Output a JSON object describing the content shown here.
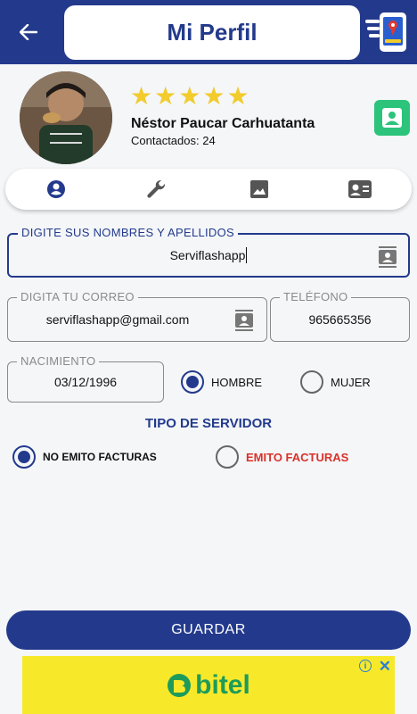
{
  "header": {
    "title": "Mi Perfil"
  },
  "colors": {
    "primary": "#233a8c",
    "star": "#f2cb2c",
    "contact_green": "#2bc47a",
    "danger_text": "#d9322b",
    "ad_bg": "#f7e92a",
    "ad_brand": "#1e9b5a"
  },
  "profile": {
    "rating_stars": 5,
    "name": "Néstor Paucar Carhuatanta",
    "contacts": "Contactados: 24"
  },
  "tabs": [
    {
      "icon": "user-circle-icon"
    },
    {
      "icon": "wrench-icon"
    },
    {
      "icon": "image-icon"
    },
    {
      "icon": "contact-card-icon"
    }
  ],
  "form": {
    "names": {
      "label": "DIGITE SUS NOMBRES Y APELLIDOS",
      "value": "Serviflashapp"
    },
    "email": {
      "label": "DIGITA TU CORREO",
      "value": "serviflashapp@gmail.com"
    },
    "phone": {
      "label": "TELÉFONO",
      "value": "965665356"
    },
    "birth": {
      "label": "NACIMIENTO",
      "value": "03/12/1996"
    },
    "gender": {
      "male": "HOMBRE",
      "female": "MUJER",
      "selected": "HOMBRE"
    },
    "server_type": {
      "title": "TIPO DE SERVIDOR",
      "no_invoice": "NO EMITO FACTURAS",
      "invoice": "EMITO FACTURAS",
      "selected": "NO EMITO FACTURAS"
    }
  },
  "actions": {
    "save": "GUARDAR"
  },
  "ad": {
    "brand": "bitel",
    "info": "i",
    "close": "✕"
  }
}
